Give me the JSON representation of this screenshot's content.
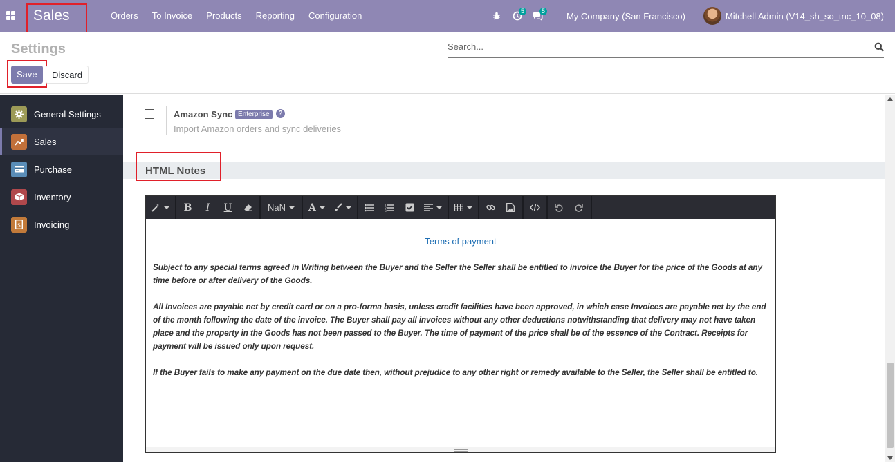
{
  "navbar": {
    "app_title": "Sales",
    "menu": [
      {
        "label": "Orders"
      },
      {
        "label": "To Invoice"
      },
      {
        "label": "Products"
      },
      {
        "label": "Reporting"
      },
      {
        "label": "Configuration"
      }
    ],
    "activity_count": "5",
    "message_count": "5",
    "company": "My Company (San Francisco)",
    "user": "Mitchell Admin (V14_sh_so_tnc_10_08)",
    "bg_color": "#8f87b4"
  },
  "control_panel": {
    "title": "Settings",
    "save_label": "Save",
    "discard_label": "Discard",
    "search_placeholder": "Search..."
  },
  "sidebar": {
    "items": [
      {
        "label": "General Settings",
        "icon": "gear-icon",
        "color": "#9c9a57"
      },
      {
        "label": "Sales",
        "icon": "chart-icon",
        "color": "#c2703a"
      },
      {
        "label": "Purchase",
        "icon": "card-icon",
        "color": "#5a8db8"
      },
      {
        "label": "Inventory",
        "icon": "box-icon",
        "color": "#b0484c"
      },
      {
        "label": "Invoicing",
        "icon": "invoice-icon",
        "color": "#c27a3a"
      }
    ]
  },
  "settings": {
    "amazon": {
      "title": "Amazon Sync",
      "badge": "Enterprise",
      "description": "Import Amazon orders and sync deliveries"
    },
    "section_title": "HTML Notes"
  },
  "editor": {
    "font_size_label": "NaN",
    "heading": "Terms of payment",
    "paragraphs": [
      "Subject to any special terms agreed in Writing between the Buyer and the Seller the Seller shall be entitled to invoice the Buyer for the price of the Goods at any time before or after delivery of the Goods.",
      "All Invoices are payable net by credit card or on a pro-forma basis, unless credit facilities have been approved, in which case Invoices are payable net by the end of the month following the date of the invoice. The Buyer shall pay all invoices without any other deductions notwithstanding that delivery may not have taken place and the property in the Goods has not been passed to the Buyer. The time of payment of the price shall be of the essence of the Contract. Receipts for payment will be issued only upon request.",
      "If the Buyer fails to make any payment on the due date then, without prejudice to any other right or remedy available to the Seller, the Seller shall be entitled to."
    ]
  }
}
